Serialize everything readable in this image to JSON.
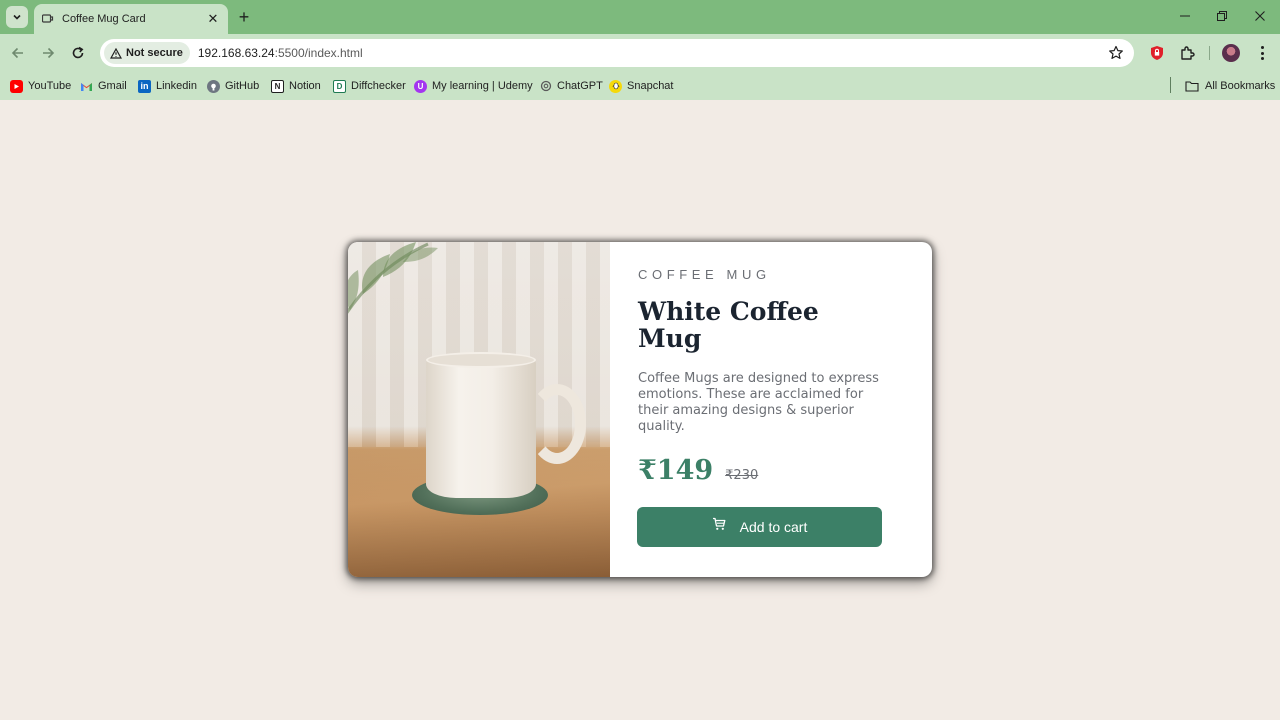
{
  "browser": {
    "tab_title": "Coffee Mug Card",
    "tab_close": "✕",
    "new_tab": "+",
    "security_label": "Not secure",
    "url_host": "192.168.63.24",
    "url_rest": ":5500/index.html",
    "bookmarks": [
      {
        "label": "YouTube",
        "icon": "youtube-icon",
        "color": "#ff0000"
      },
      {
        "label": "Gmail",
        "icon": "gmail-icon",
        "color": "#ea4335"
      },
      {
        "label": "Linkedin",
        "icon": "linkedin-icon",
        "color": "#0a66c2"
      },
      {
        "label": "GitHub",
        "icon": "github-icon",
        "color": "#4a4a4a"
      },
      {
        "label": "Notion",
        "icon": "notion-icon",
        "color": "#1f1f1f"
      },
      {
        "label": "Diffchecker",
        "icon": "diffchecker-icon",
        "color": "#1f7a52"
      },
      {
        "label": "My learning | Udemy",
        "icon": "udemy-icon",
        "color": "#a435f0"
      },
      {
        "label": "ChatGPT",
        "icon": "chatgpt-icon",
        "color": "#5a5a5a"
      },
      {
        "label": "Snapchat",
        "icon": "snapchat-icon",
        "color": "#f5d90a"
      }
    ],
    "all_bookmarks": "All Bookmarks"
  },
  "card": {
    "category": "COFFEE MUG",
    "title": "White Coffee Mug",
    "description": "Coffee Mugs are designed to express emotions. These are acclaimed for their amazing designs & superior quality.",
    "price": "₹149",
    "old_price": "₹230",
    "button_label": "Add to cart"
  },
  "colors": {
    "accent": "#3c8067",
    "page_bg": "#f2ebe5",
    "chrome_green": "#7dba7d",
    "toolbar_green": "#c9e3c7"
  }
}
